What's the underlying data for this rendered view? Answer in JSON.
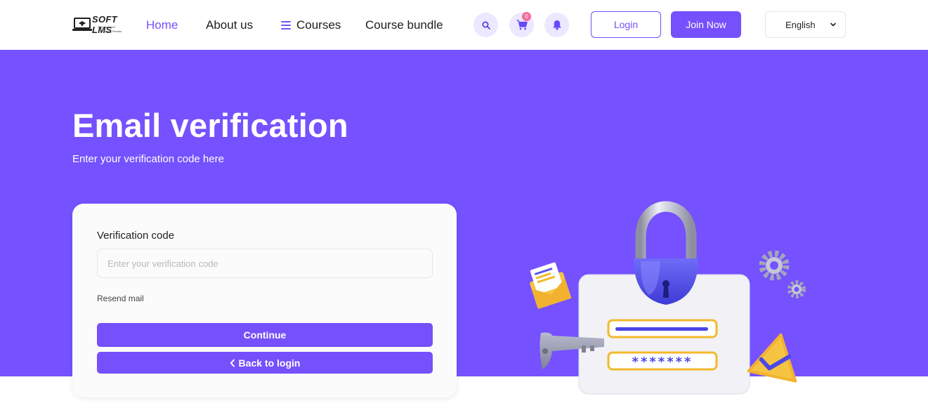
{
  "header": {
    "logo": {
      "text": "SOFT LMS",
      "tagline_1": "Self-Improved",
      "tagline_2": "Strong Results"
    },
    "nav": {
      "home": "Home",
      "about": "About us",
      "courses": "Courses",
      "bundle": "Course bundle"
    },
    "cart_count": "0",
    "login_label": "Login",
    "join_label": "Join Now",
    "language": {
      "selected": "English"
    }
  },
  "hero": {
    "title": "Email verification",
    "subtitle": "Enter your verification code here"
  },
  "form": {
    "label": "Verification code",
    "placeholder": "Enter your verification code",
    "value": "",
    "resend_label": "Resend mail",
    "continue_label": "Continue",
    "back_label": "Back to login"
  },
  "illustration": {
    "password_mask": "*******"
  },
  "colors": {
    "brand": "#7550fb",
    "hero_bg": "#7551ff",
    "badge": "#f46b9e",
    "icon_bg": "#ece8ff"
  },
  "icons": [
    "search-icon",
    "cart-icon",
    "bell-icon",
    "menu-icon",
    "chevron-down-icon",
    "chevron-left-icon"
  ]
}
